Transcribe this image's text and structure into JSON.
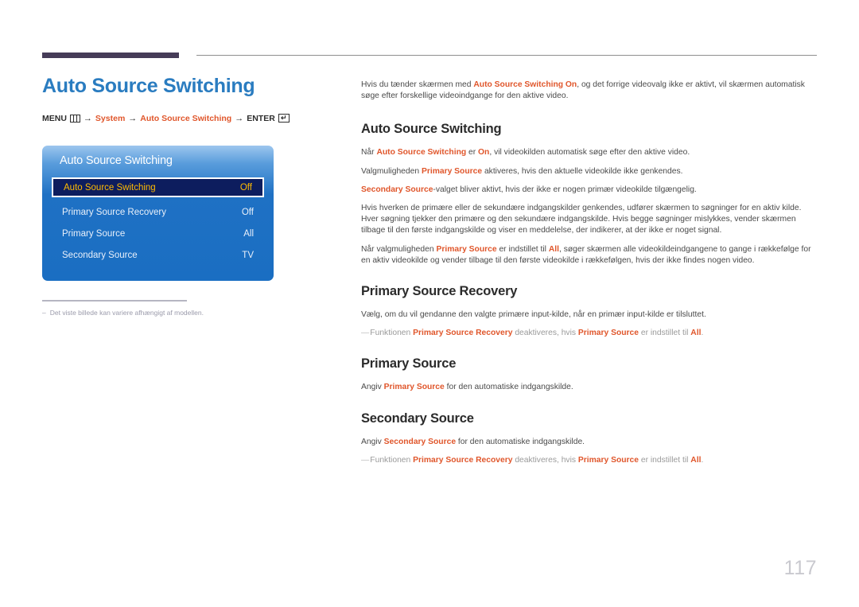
{
  "page": {
    "number": "117"
  },
  "left": {
    "title": "Auto Source Switching",
    "breadcrumb": {
      "menu_label": "MENU",
      "menu_icon": "menu-grid-icon",
      "arrow": "→",
      "crumb1": "System",
      "crumb2": "Auto Source Switching",
      "enter_label": "ENTER",
      "enter_icon": "enter-key-icon",
      "enter_glyph": "↵"
    },
    "osd": {
      "title": "Auto Source Switching",
      "rows": [
        {
          "label": "Auto Source Switching",
          "value": "Off",
          "selected": true
        },
        {
          "label": "Primary Source Recovery",
          "value": "Off",
          "selected": false
        },
        {
          "label": "Primary Source",
          "value": "All",
          "selected": false
        },
        {
          "label": "Secondary Source",
          "value": "TV",
          "selected": false
        }
      ]
    },
    "note": {
      "dash": "–",
      "text": "Det viste billede kan variere afhængigt af modellen."
    }
  },
  "right": {
    "intro": {
      "pre": "Hvis du tænder skærmen med ",
      "bold": "Auto Source Switching On",
      "post": ", og det forrige videovalg ikke er aktivt, vil skærmen automatisk søge efter forskellige videoindgange for den aktive video."
    },
    "sections": [
      {
        "heading": "Auto Source Switching",
        "paragraphs": [
          {
            "parts": [
              {
                "t": "Når ",
                "b": false
              },
              {
                "t": "Auto Source Switching",
                "b": true
              },
              {
                "t": " er ",
                "b": false
              },
              {
                "t": "On",
                "b": true
              },
              {
                "t": ", vil videokilden automatisk søge efter den aktive video.",
                "b": false
              }
            ]
          },
          {
            "parts": [
              {
                "t": "Valgmuligheden ",
                "b": false
              },
              {
                "t": "Primary Source",
                "b": true
              },
              {
                "t": " aktiveres, hvis den aktuelle videokilde ikke genkendes.",
                "b": false
              }
            ]
          },
          {
            "parts": [
              {
                "t": "Secondary Source",
                "b": true
              },
              {
                "t": "-valget bliver aktivt, hvis der ikke er nogen primær videokilde tilgængelig.",
                "b": false
              }
            ]
          },
          {
            "parts": [
              {
                "t": "Hvis hverken de primære eller de sekundære indgangskilder genkendes, udfører skærmen to søgninger for en aktiv kilde. Hver søgning tjekker den primære og den sekundære indgangskilde. Hvis begge søgninger mislykkes, vender skærmen tilbage til den første indgangskilde og viser en meddelelse, der indikerer, at der ikke er noget signal.",
                "b": false
              }
            ]
          },
          {
            "parts": [
              {
                "t": "Når valgmuligheden ",
                "b": false
              },
              {
                "t": "Primary Source",
                "b": true
              },
              {
                "t": " er indstillet til ",
                "b": false
              },
              {
                "t": "All",
                "b": true
              },
              {
                "t": ", søger skærmen alle videokildeindgangene to gange i rækkefølge for en aktiv videokilde og vender tilbage til den første videokilde i rækkefølgen, hvis der ikke findes nogen video.",
                "b": false
              }
            ]
          }
        ],
        "notes": []
      },
      {
        "heading": "Primary Source Recovery",
        "paragraphs": [
          {
            "parts": [
              {
                "t": "Vælg, om du vil gendanne den valgte primære input-kilde, når en primær input-kilde er tilsluttet.",
                "b": false
              }
            ]
          }
        ],
        "notes": [
          {
            "dash": "—",
            "parts": [
              {
                "t": "Funktionen ",
                "b": false
              },
              {
                "t": "Primary Source Recovery",
                "b": true
              },
              {
                "t": " deaktiveres, hvis ",
                "b": false
              },
              {
                "t": "Primary Source",
                "b": true
              },
              {
                "t": " er indstillet til ",
                "b": false
              },
              {
                "t": "All",
                "b": true
              },
              {
                "t": ".",
                "b": false
              }
            ]
          }
        ]
      },
      {
        "heading": "Primary Source",
        "paragraphs": [
          {
            "parts": [
              {
                "t": "Angiv ",
                "b": false
              },
              {
                "t": "Primary Source",
                "b": true
              },
              {
                "t": " for den automatiske indgangskilde.",
                "b": false
              }
            ]
          }
        ],
        "notes": []
      },
      {
        "heading": "Secondary Source",
        "paragraphs": [
          {
            "parts": [
              {
                "t": "Angiv ",
                "b": false
              },
              {
                "t": "Secondary Source",
                "b": true
              },
              {
                "t": " for den automatiske indgangskilde.",
                "b": false
              }
            ]
          }
        ],
        "notes": [
          {
            "dash": "—",
            "parts": [
              {
                "t": "Funktionen ",
                "b": false
              },
              {
                "t": "Primary Source Recovery",
                "b": true
              },
              {
                "t": " deaktiveres, hvis ",
                "b": false
              },
              {
                "t": "Primary Source",
                "b": true
              },
              {
                "t": " er indstillet til ",
                "b": false
              },
              {
                "t": "All",
                "b": true
              },
              {
                "t": ".",
                "b": false
              }
            ]
          }
        ]
      }
    ]
  },
  "colors": {
    "title_blue": "#2a7cc0",
    "accent_orange": "#e0562b",
    "top_bar": "#463c58",
    "osd_blue": "#1a6ec2",
    "osd_selected_bg": "#0d1d5e",
    "osd_selected_text": "#ffbb00",
    "page_number": "#c9c9cf"
  }
}
